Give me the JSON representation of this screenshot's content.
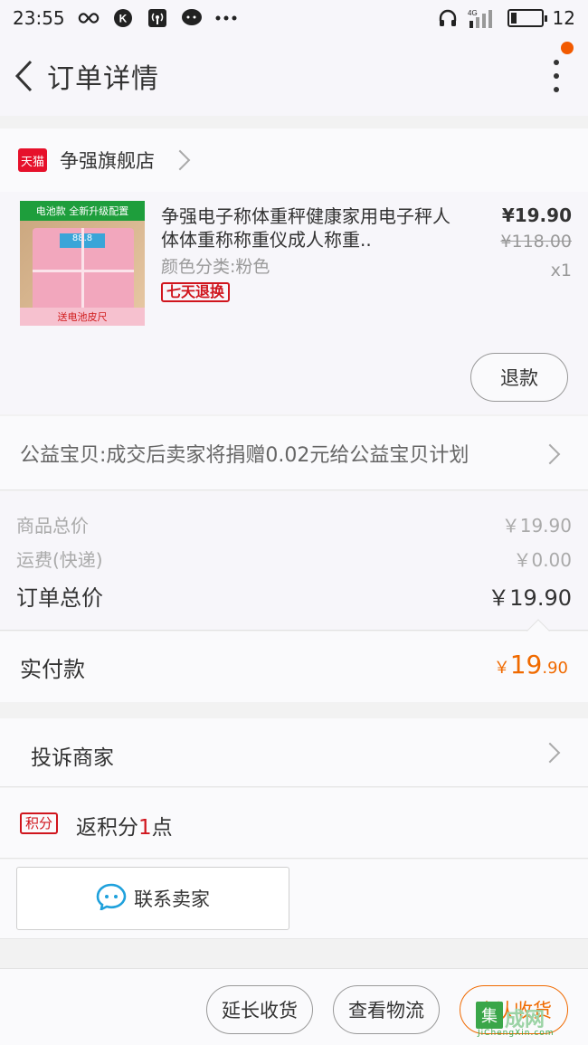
{
  "status_bar": {
    "time": "23:55",
    "network": "4G",
    "battery_level": "12"
  },
  "nav": {
    "title": "订单详情"
  },
  "store": {
    "logo_text": "天猫",
    "name": "争强旗舰店"
  },
  "product": {
    "title": "争强电子称体重秤健康家用电子秤人体体重称称重仪成人称重..",
    "sku": "颜色分类:粉色",
    "tag": "七天退换",
    "price": "¥19.90",
    "original_price": "¥118.00",
    "quantity": "x1",
    "thumb_banner": "电池款 全新升级配置",
    "thumb_lcd": "88.8",
    "thumb_label": "送电池皮尺",
    "refund_label": "退款"
  },
  "charity": {
    "text": "公益宝贝:成交后卖家将捐赠0.02元给公益宝贝计划"
  },
  "prices": {
    "goods_total_label": "商品总价",
    "goods_total_value": "￥19.90",
    "shipping_label": "运费(快递)",
    "shipping_value": "￥0.00",
    "order_total_label": "订单总价",
    "order_total_value": "￥19.90"
  },
  "paid": {
    "label": "实付款",
    "currency": "￥",
    "integer": "19",
    "decimal": ".90"
  },
  "complain": {
    "label": "投诉商家"
  },
  "points": {
    "tag": "积分",
    "prefix": "返积分",
    "number": "1",
    "suffix": "点"
  },
  "contact": {
    "label": "联系卖家"
  },
  "actions": {
    "extend_label": "延长收货",
    "logistics_label": "查看物流",
    "confirm_label": "确认收货"
  },
  "watermark": {
    "box_text": "集",
    "text": "成网",
    "sub": "JiChengXin.com"
  },
  "colors": {
    "accent_orange": "#f06a00",
    "tmall_red": "#e6112b",
    "tag_red": "#d0151d"
  }
}
